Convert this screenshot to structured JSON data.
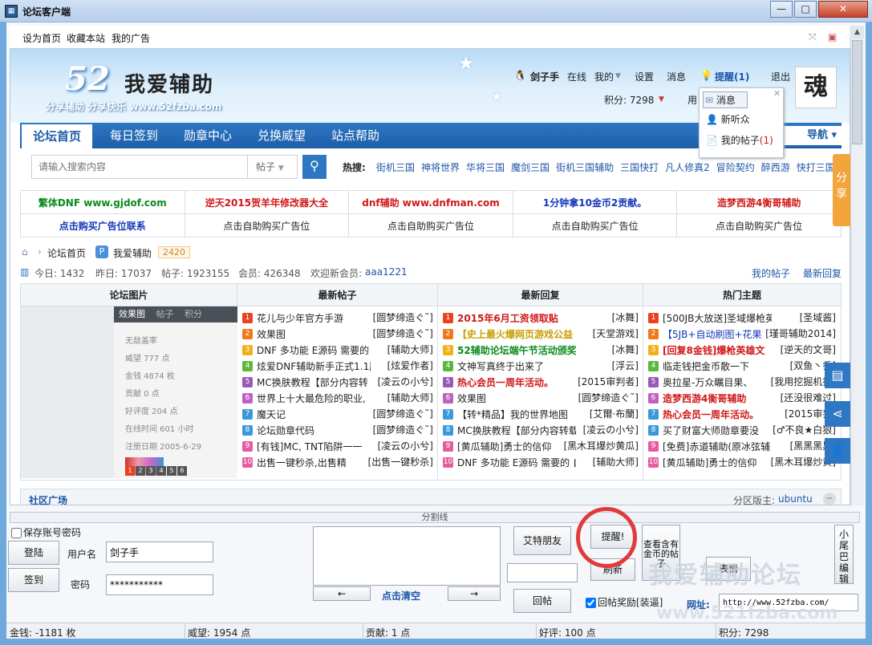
{
  "window": {
    "title": "论坛客户端",
    "min": "—",
    "max": "□",
    "close": "✕"
  },
  "toplinks": [
    "设为首页",
    "收藏本站",
    "我的广告"
  ],
  "banner": {
    "logo_num": "52",
    "logo_text": "我爱辅助",
    "slogan": "分享辅助 分享快乐 www.52fzba.com"
  },
  "user": {
    "name": "剑子手",
    "status": "在线",
    "my": "我的",
    "settings": "设置",
    "messages": "消息",
    "alert": "提醒(1)",
    "logout": "退出",
    "credits": "积分: 7298",
    "use": "用"
  },
  "popup": {
    "items": [
      "消息",
      "新听众",
      "我的帖子"
    ],
    "count": "(1)"
  },
  "nav": {
    "tabs": [
      "论坛首页",
      "每日签到",
      "勋章中心",
      "兑换威望",
      "站点帮助"
    ],
    "quick": "导航 ▾"
  },
  "search": {
    "placeholder": "请输入搜索内容",
    "type": "帖子",
    "hot_label": "热搜:",
    "hot": [
      "街机三国",
      "神将世界",
      "华将三国",
      "魔剑三国",
      "街机三国辅助",
      "三国快打",
      "凡人修真2",
      "冒险契约",
      "醉西游",
      "快打三国"
    ]
  },
  "ads": {
    "row1": [
      "繁体DNF www.gjdof.com",
      "逆天2015贺羊年修改器大全",
      "dnf辅助 www.dnfman.com",
      "1分钟拿10金币2贡献。",
      "造梦西游4衡哥辅助"
    ],
    "row2": [
      "点击购买广告位联系",
      "点击自助购买广告位",
      "点击自助购买广告位",
      "点击自助购买广告位",
      "点击自助购买广告位"
    ],
    "colors1": [
      "#0a8a1a",
      "#d01818",
      "#d01818",
      "#1437b8",
      "#d01818"
    ]
  },
  "crumb": {
    "home": "论坛首页",
    "forum": "我爱辅助",
    "count": "2420"
  },
  "stats": {
    "today": "今日: 1432",
    "yesterday": "昨日: 17037",
    "posts": "帖子: 1923155",
    "members": "会员: 426348",
    "welcome": "欢迎新会员:",
    "new_member": "aaa1221",
    "my_posts": "我的帖子",
    "latest": "最新回复"
  },
  "ftable": {
    "headers": [
      "论坛图片",
      "最新帖子",
      "最新回复",
      "热门主题"
    ],
    "pic_tabs": [
      "效果图",
      "帖子",
      "积分"
    ],
    "pic_profile": [
      "无敌盖率",
      "威望  777 点",
      "金钱  4874 枚",
      "贡献  0 点",
      "好评度  204 点",
      "在线时间  601 小时",
      "注册日期  2005-6-29"
    ],
    "pic_dots": [
      "1",
      "2",
      "3",
      "4",
      "5",
      "6"
    ],
    "col1": [
      {
        "t": "花儿与少年官方手游",
        "a": "[圆梦缔造ぐ˜]"
      },
      {
        "t": "效果图",
        "a": "[圆梦缔造ぐ˜]"
      },
      {
        "t": "DNF 多功能 E源码 需要的",
        "a": "[辅助大师]"
      },
      {
        "t": "炫爱DNF辅助新手正式1.1版",
        "a": "[炫爱作者]"
      },
      {
        "t": "MC换肤教程【部分内容转",
        "a": "[凌云の小兮]"
      },
      {
        "t": "世界上十大最危险的职业,",
        "a": "[辅助大师]"
      },
      {
        "t": "魔天记",
        "a": "[圆梦缔造ぐ˜]"
      },
      {
        "t": "论坛勋章代码",
        "a": "[圆梦缔造ぐ˜]"
      },
      {
        "t": "[有钱]MC, TNT陷阱一一",
        "a": "[凌云の小兮]"
      },
      {
        "t": "出售一键秒杀,出售精",
        "a": "[出售一键秒杀]"
      }
    ],
    "col2": [
      {
        "t": "2015年6月工资领取贴",
        "a": "[冰舞]",
        "c": "#d01818",
        "b": true
      },
      {
        "t": "【史上最火爆网页游戏公益",
        "a": "[天堂游戏]",
        "c": "#c8a000",
        "b": true
      },
      {
        "t": "52辅助论坛端午节活动颁奖",
        "a": "[冰舞]",
        "c": "#0a8a1a",
        "b": true
      },
      {
        "t": "文神写真终于出来了",
        "a": "[浮云]",
        "c": "#222",
        "b": false
      },
      {
        "t": "热心会员一周年活动。",
        "a": "[2015审判者]",
        "c": "#d01818",
        "b": true
      },
      {
        "t": "效果图",
        "a": "[圆梦缔造ぐ˜]",
        "c": "#222",
        "b": false
      },
      {
        "t": "【转*精品】我的世界地图",
        "a": "[艾爾·布蘭]",
        "c": "#222",
        "b": false
      },
      {
        "t": "MC换肤教程【部分内容转载",
        "a": "[凌云の小兮]",
        "c": "#222",
        "b": false
      },
      {
        "t": "[黄瓜辅助]勇士的信仰",
        "a": "[黑木耳爆炒黄瓜]",
        "c": "#222",
        "b": false
      },
      {
        "t": "DNF 多功能 E源码 需要的 自",
        "a": "[辅助大师]",
        "c": "#222",
        "b": false
      }
    ],
    "col3": [
      {
        "t": "[500JB大放送]圣域爆枪英雄辅",
        "a": "[圣域酱]",
        "c": "#222",
        "b": false
      },
      {
        "t": "【5JB+自动刷图+花果",
        "a": "[瑾哥辅助2014]",
        "c": "#1437b8",
        "b": false
      },
      {
        "t": "[回复8金钱]爆枪英雄文",
        "a": "[逆天的文哥]",
        "c": "#d01818",
        "b": true
      },
      {
        "t": "临走钱把金币散一下",
        "a": "[双鱼丶乔]",
        "c": "#222",
        "b": false
      },
      {
        "t": "奥拉星-万众瞩目果、",
        "a": "[我用挖掘机打]",
        "c": "#222",
        "b": false
      },
      {
        "t": "造梦西游4衡哥辅助",
        "a": "[还没很难过]",
        "c": "#d01818",
        "b": true
      },
      {
        "t": "热心会员一周年活动。",
        "a": "[2015审判]",
        "c": "#d01818",
        "b": true
      },
      {
        "t": "买了财富大师勋章要没",
        "a": "[♂不良★白狼]",
        "c": "#222",
        "b": false
      },
      {
        "t": "[免费]赤道辅助(原冰弦辅",
        "a": "[黑黑黑黑]",
        "c": "#222",
        "b": false
      },
      {
        "t": "[黄瓜辅助]勇士的信仰",
        "a": "[黑木耳爆炒黄]",
        "c": "#222",
        "b": false
      }
    ],
    "num_colors": [
      "#e8421f",
      "#f07a1a",
      "#f0b21a",
      "#5cb83a",
      "#9b59b6",
      "#c060c0",
      "#3a9ad9",
      "#3a9ad9",
      "#e55ca0",
      "#e55ca0"
    ]
  },
  "community": {
    "title": "社区广场",
    "moderator_label": "分区版主:",
    "moderator": "ubuntu"
  },
  "side": {
    "share": "分享"
  },
  "bottom": {
    "divider": "分割线",
    "save_pw": "保存账号密码",
    "login": "登陆",
    "signin": "签到",
    "user_label": "用户名",
    "user_value": "剑子手",
    "pw_label": "密码",
    "pw_value": "***********",
    "prev": "←",
    "clear": "点击清空",
    "next": "→",
    "at_friend": "艾特朋友",
    "alert": "提醒!",
    "refresh": "刷新",
    "view_gold": "查看含有金币的帖子",
    "emoji": "表情",
    "reply": "回帖",
    "reward": "回帖奖励[装逼]",
    "url_label": "网址:",
    "url_value": "http://www.52fzba.com/",
    "tail_edit": "小尾巴编辑"
  },
  "watermark": "我爱辅助论坛",
  "watermark_url": "www.521fzba.com",
  "status": {
    "gold": "金钱: -1181 枚",
    "prestige": "威望: 1954 点",
    "contrib": "贡献: 1 点",
    "rating": "好评: 100 点",
    "points": "积分: 7298"
  }
}
